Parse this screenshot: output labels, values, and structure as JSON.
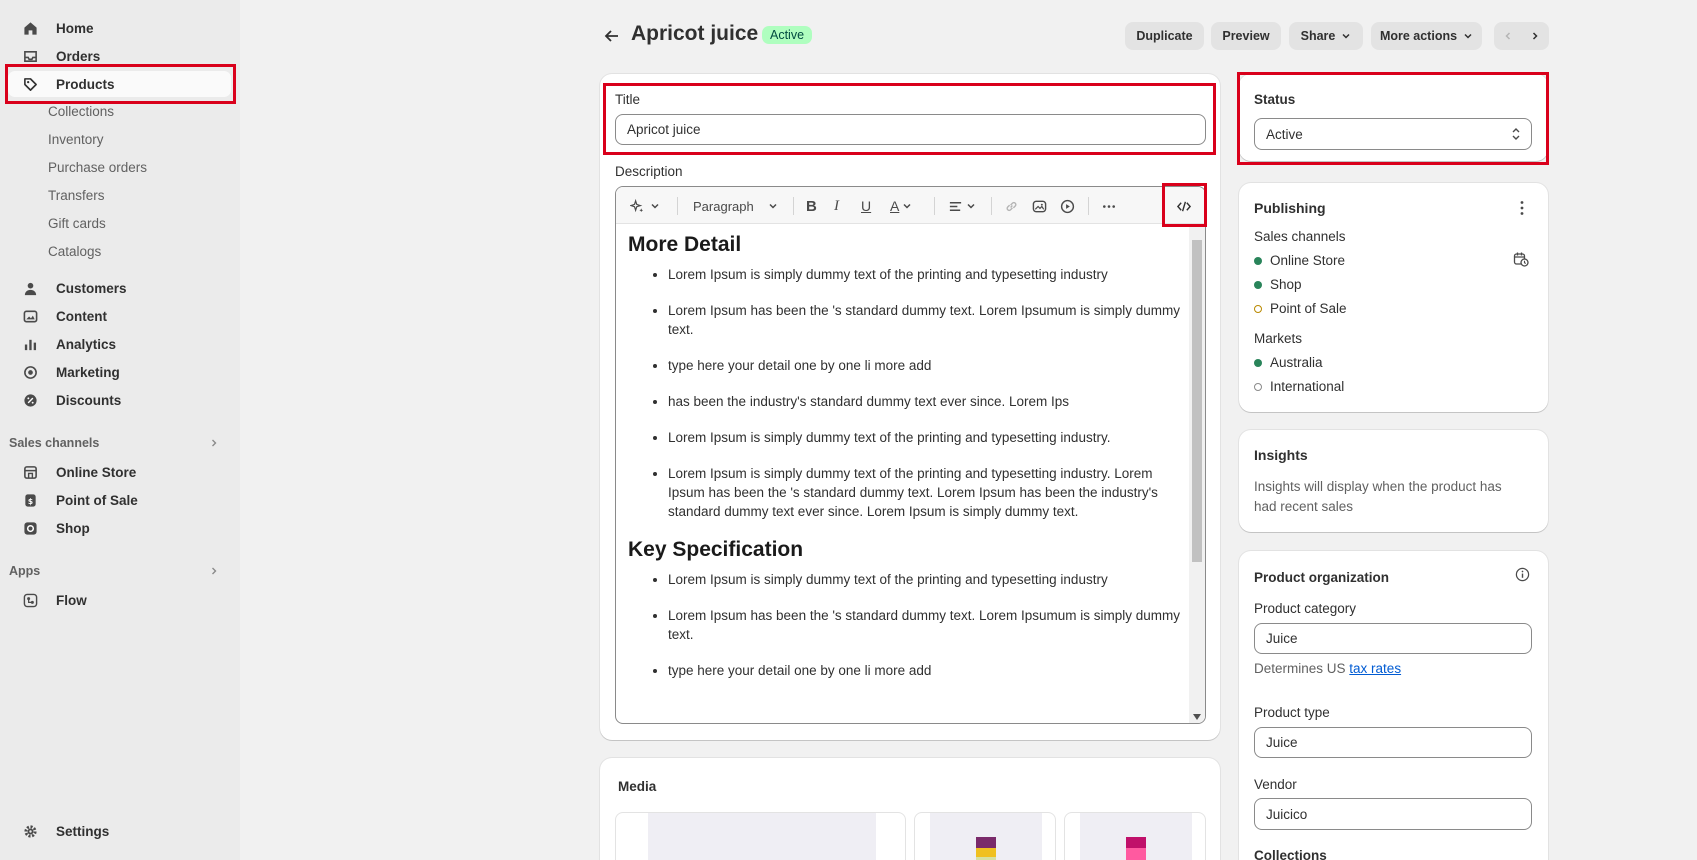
{
  "nav": {
    "home": "Home",
    "orders": "Orders",
    "products": "Products",
    "products_sub": [
      "Collections",
      "Inventory",
      "Purchase orders",
      "Transfers",
      "Gift cards",
      "Catalogs"
    ],
    "customers": "Customers",
    "content": "Content",
    "analytics": "Analytics",
    "marketing": "Marketing",
    "discounts": "Discounts",
    "sales_channels_heading": "Sales channels",
    "online_store": "Online Store",
    "point_of_sale": "Point of Sale",
    "shop": "Shop",
    "apps_heading": "Apps",
    "flow": "Flow",
    "settings": "Settings"
  },
  "header": {
    "title": "Apricot juice",
    "status_badge": "Active",
    "duplicate": "Duplicate",
    "preview": "Preview",
    "share": "Share",
    "more_actions": "More actions"
  },
  "product": {
    "title_label": "Title",
    "title_value": "Apricot juice",
    "description_label": "Description",
    "toolbar_paragraph": "Paragraph",
    "sections": [
      {
        "heading": "More Detail",
        "items": [
          "Lorem Ipsum is simply dummy text of the printing and typesetting industry",
          "Lorem Ipsum has been the 's standard dummy text. Lorem Ipsumum is simply dummy text.",
          "type here your detail one by one li more add",
          "has been the industry's standard dummy text ever since. Lorem Ips",
          "Lorem Ipsum is simply dummy text of the printing and typesetting industry.",
          "Lorem Ipsum is simply dummy text of the printing and typesetting industry. Lorem Ipsum has been the 's standard dummy text. Lorem Ipsum has been the industry's standard dummy text ever since. Lorem Ipsum is simply dummy text."
        ]
      },
      {
        "heading": "Key Specification",
        "items": [
          "Lorem Ipsum is simply dummy text of the printing and typesetting industry",
          "Lorem Ipsum has been the 's standard dummy text. Lorem Ipsumum is simply dummy text.",
          "type here your detail one by one li more add"
        ]
      }
    ],
    "media_label": "Media"
  },
  "status": {
    "label": "Status",
    "value": "Active"
  },
  "publishing": {
    "title": "Publishing",
    "sales_channels_label": "Sales channels",
    "channels": [
      "Online Store",
      "Shop",
      "Point of Sale"
    ],
    "markets_label": "Markets",
    "markets": [
      "Australia",
      "International"
    ]
  },
  "insights": {
    "title": "Insights",
    "text": "Insights will display when the product has had recent sales"
  },
  "organization": {
    "title": "Product organization",
    "category_label": "Product category",
    "category_value": "Juice",
    "tax_prefix": "Determines US",
    "tax_link": "tax rates",
    "type_label": "Product type",
    "type_value": "Juice",
    "vendor_label": "Vendor",
    "vendor_value": "Juicico",
    "collections_label": "Collections"
  },
  "colors": {
    "highlight": "#d9001b",
    "active_dot": "#29845a",
    "pending_dot": "#b98900",
    "badge_bg": "#affebf"
  }
}
